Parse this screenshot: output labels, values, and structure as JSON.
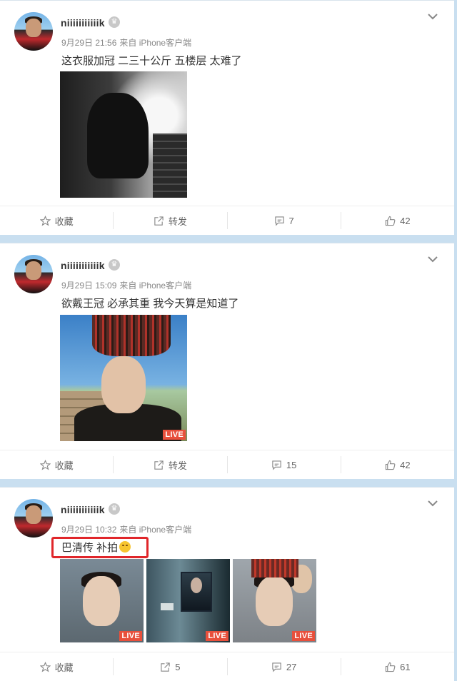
{
  "posts": [
    {
      "username": "niiiiiiiiiiik",
      "date": "9月29日 21:56",
      "source": "来自 iPhone客户端",
      "text": "这衣服加冠 二三十公斤 五楼层 太难了",
      "images": [
        {
          "type": "photo",
          "live": false
        }
      ],
      "actions": {
        "favorite": "收藏",
        "repost": "转发",
        "comments": "7",
        "likes": "42"
      }
    },
    {
      "username": "niiiiiiiiiiik",
      "date": "9月29日 15:09",
      "source": "来自 iPhone客户端",
      "text": "欲戴王冠 必承其重 我今天算是知道了",
      "images": [
        {
          "type": "photo",
          "live": true,
          "live_label": "LIVE"
        }
      ],
      "actions": {
        "favorite": "收藏",
        "repost": "转发",
        "comments": "15",
        "likes": "42"
      }
    },
    {
      "username": "niiiiiiiiiiik",
      "date": "9月29日 10:32",
      "source": "来自 iPhone客户端",
      "text": "巴清传 补拍",
      "emoji": "smile-emoji",
      "images": [
        {
          "type": "photo",
          "live": true,
          "live_label": "LIVE"
        },
        {
          "type": "photo",
          "live": true,
          "live_label": "LIVE"
        },
        {
          "type": "photo",
          "live": true,
          "live_label": "LIVE"
        }
      ],
      "actions": {
        "favorite": "收藏",
        "repost": "5",
        "comments": "27",
        "likes": "61"
      }
    }
  ],
  "annotation": {
    "highlight_color": "#e0262a"
  },
  "colors": {
    "background": "#c9dff0",
    "live_badge": "#e8503c"
  },
  "icons": [
    "crown-icon",
    "chevron-down-icon",
    "star-icon",
    "share-icon",
    "comment-icon",
    "thumbs-up-icon",
    "smile-emoji"
  ]
}
